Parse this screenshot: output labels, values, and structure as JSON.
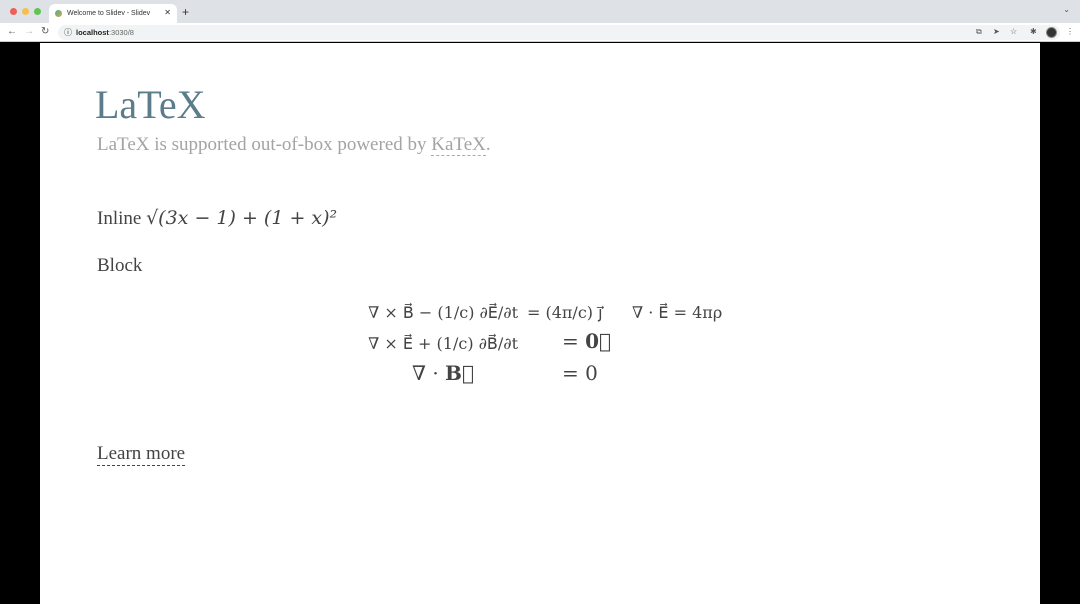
{
  "browser": {
    "tab_title": "Welcome to Slidev - Slidev",
    "url_host": "localhost",
    "url_path": ":3030/8"
  },
  "slide": {
    "title": "LaTeX",
    "subtitle_prefix": "LaTeX is supported out-of-box powered by ",
    "subtitle_link": "KaTeX",
    "subtitle_suffix": ".",
    "inline_label": "Inline",
    "inline_math": "√(3x − 1) + (1 + x)²",
    "block_label": "Block",
    "equations": [
      {
        "lhs": "∇ × B⃗ − (1/c) ∂E⃗/∂t",
        "rhs": "= (4π/c) j⃗",
        "extra": "∇ · E⃗ = 4πρ"
      },
      {
        "lhs": "∇ × E⃗ + (1/c) ∂B⃗/∂t",
        "rhs": "= 0⃗"
      },
      {
        "lhs": "∇ · B⃗",
        "rhs": "= 0"
      }
    ],
    "learn_more": "Learn more"
  },
  "colors": {
    "title": "#5b7c8a",
    "subtitle": "#a3a3a3",
    "text": "#444444"
  }
}
